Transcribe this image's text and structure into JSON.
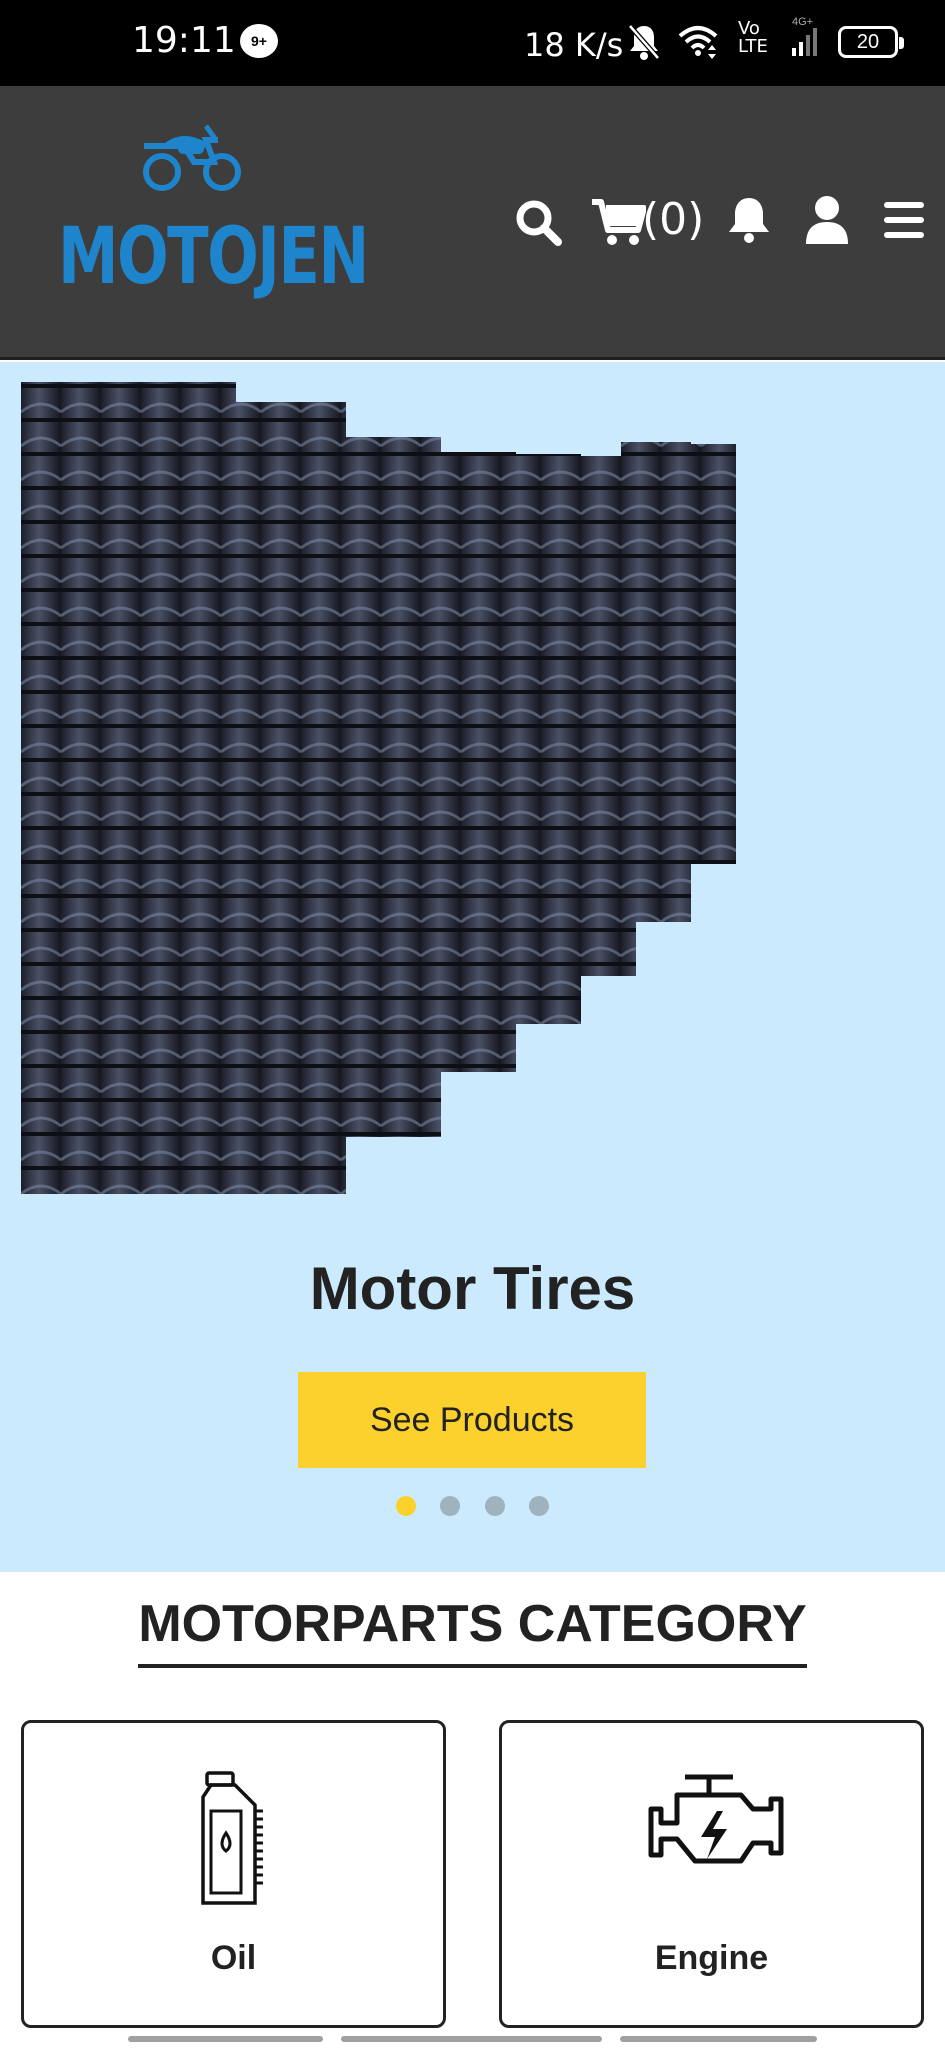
{
  "status_bar": {
    "time": "19:11",
    "notification": "9+",
    "net_speed": "18 K/s",
    "volte": "Vo\nLTE",
    "signal_label": "4G+",
    "battery": "20"
  },
  "header": {
    "logo_text": "MOTOJEN",
    "cart_count": "(0)",
    "icons": [
      "search-icon",
      "cart-icon",
      "bell-icon",
      "user-icon",
      "menu-icon"
    ],
    "colors": {
      "background": "#3d3d3d",
      "logo": "#1e84cc"
    }
  },
  "hero": {
    "title": "Motor Tires",
    "button_label": "See Products",
    "slide_count": 4,
    "active_slide": 1,
    "colors": {
      "background": "#cbeafd",
      "button": "#fcd12e"
    }
  },
  "category": {
    "title": "MOTORPARTS CATEGORY",
    "items": [
      {
        "label": "Oil",
        "icon": "oil-bottle-icon"
      },
      {
        "label": "Engine",
        "icon": "engine-icon"
      }
    ]
  }
}
